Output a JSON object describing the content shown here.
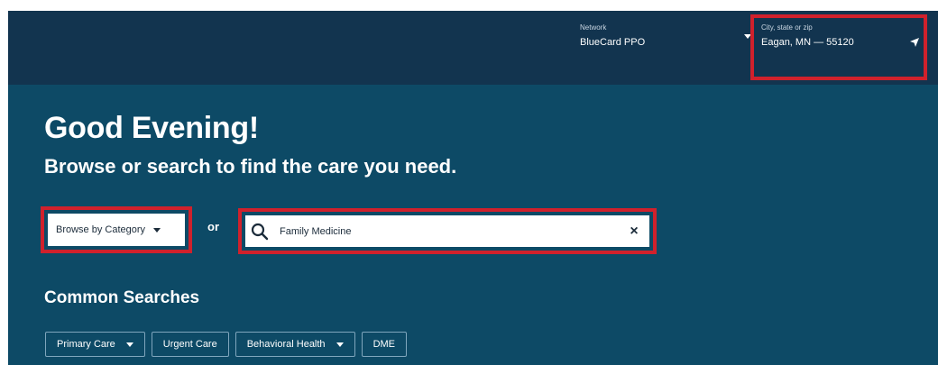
{
  "header": {
    "network": {
      "label": "Network",
      "value": "BlueCard PPO"
    },
    "location": {
      "label": "City, state or zip",
      "value": "Eagan, MN — 55120"
    }
  },
  "hero": {
    "greeting": "Good Evening!",
    "subtitle": "Browse or search to find the care you need.",
    "browse_label": "Browse by Category",
    "or_label": "or",
    "search": {
      "value": "Family Medicine",
      "clear_glyph": "×"
    },
    "common_title": "Common Searches",
    "chips": [
      {
        "label": "Primary Care"
      },
      {
        "label": "Urgent Care"
      },
      {
        "label": "Behavioral Health"
      },
      {
        "label": "DME"
      }
    ]
  },
  "colors": {
    "topbar": "#12344f",
    "hero": "#0d4a66",
    "highlight": "#d0212c"
  }
}
